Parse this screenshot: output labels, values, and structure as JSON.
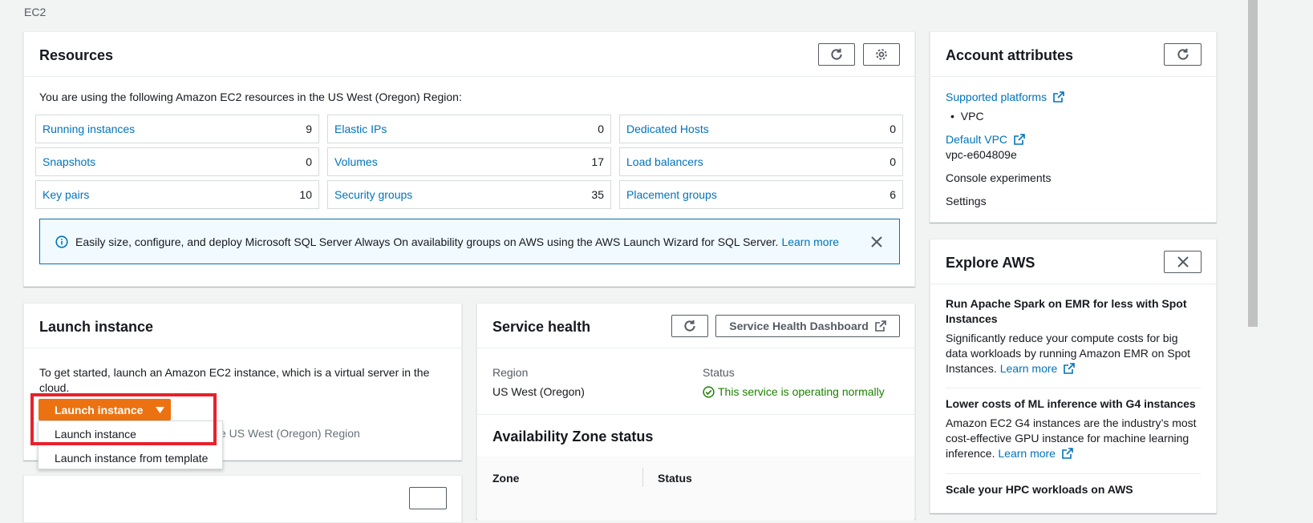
{
  "breadcrumb": "EC2",
  "resources": {
    "title": "Resources",
    "intro": "You are using the following Amazon EC2 resources in the US West (Oregon) Region:",
    "cells": [
      {
        "label": "Running instances",
        "value": "9"
      },
      {
        "label": "Elastic IPs",
        "value": "0"
      },
      {
        "label": "Dedicated Hosts",
        "value": "0"
      },
      {
        "label": "Snapshots",
        "value": "0"
      },
      {
        "label": "Volumes",
        "value": "17"
      },
      {
        "label": "Load balancers",
        "value": "0"
      },
      {
        "label": "Key pairs",
        "value": "10"
      },
      {
        "label": "Security groups",
        "value": "35"
      },
      {
        "label": "Placement groups",
        "value": "6"
      }
    ],
    "banner_text": "Easily size, configure, and deploy Microsoft SQL Server Always On availability groups on AWS using the AWS Launch Wizard for SQL Server.",
    "banner_link": "Learn more"
  },
  "account": {
    "title": "Account attributes",
    "supported_platforms": "Supported platforms",
    "vpc_bullet": "VPC",
    "default_vpc": "Default VPC",
    "vpc_id": "vpc-e604809e",
    "console_experiments": "Console experiments",
    "settings": "Settings"
  },
  "explore": {
    "title": "Explore AWS",
    "items": [
      {
        "title": "Run Apache Spark on EMR for less with Spot Instances",
        "body": "Significantly reduce your compute costs for big data workloads by running Amazon EMR on Spot Instances.",
        "link": "Learn more"
      },
      {
        "title": "Lower costs of ML inference with G4 instances",
        "body": "Amazon EC2 G4 instances are the industry’s most cost-effective GPU instance for machine learning inference.",
        "link": "Learn more"
      },
      {
        "title": "Scale your HPC workloads on AWS"
      }
    ]
  },
  "launch": {
    "title": "Launch instance",
    "intro": "To get started, launch an Amazon EC2 instance, which is a virtual server in the cloud.",
    "button": "Launch instance",
    "behind_text": "e US West (Oregon) Region",
    "menu": [
      "Launch instance",
      "Launch instance from template"
    ]
  },
  "health": {
    "title": "Service health",
    "dashboard_button": "Service Health Dashboard",
    "region_label": "Region",
    "region_value": "US West (Oregon)",
    "status_label": "Status",
    "status_value": "This service is operating normally",
    "az_title": "Availability Zone status",
    "az_col_zone": "Zone",
    "az_col_status": "Status"
  },
  "colors": {
    "link": "#0073bb",
    "primary": "#ec7211",
    "success": "#1d8102",
    "highlight": "#e8212c"
  }
}
